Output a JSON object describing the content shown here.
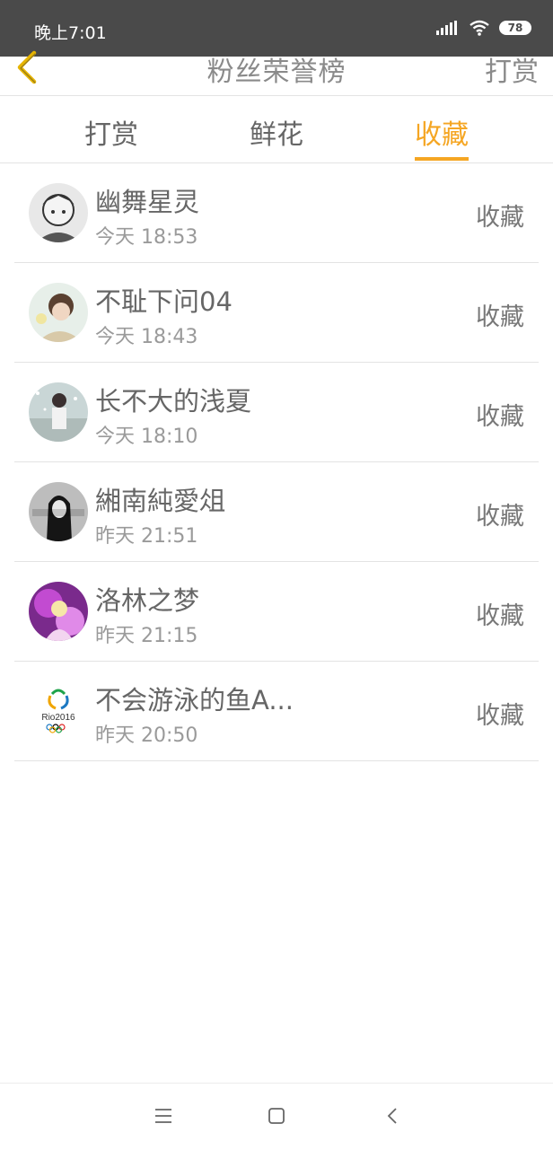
{
  "status": {
    "time": "晚上7:01",
    "battery": "78"
  },
  "header": {
    "title": "粉丝荣誉榜",
    "right_action": "打赏"
  },
  "tabs": [
    {
      "label": "打赏"
    },
    {
      "label": "鲜花"
    },
    {
      "label": "收藏"
    }
  ],
  "active_tab": "收藏",
  "fans": [
    {
      "name": "幽舞星灵",
      "time": "今天 18:53",
      "tag": "收藏"
    },
    {
      "name": "不耻下问04",
      "time": "今天 18:43",
      "tag": "收藏"
    },
    {
      "name": "长不大的浅夏",
      "time": "今天 18:10",
      "tag": "收藏"
    },
    {
      "name": "緗南純愛俎",
      "time": "昨天 21:51",
      "tag": "收藏"
    },
    {
      "name": "洛林之梦",
      "time": "昨天 21:15",
      "tag": "收藏"
    },
    {
      "name": "不会游泳的鱼A...",
      "time": "昨天 20:50",
      "tag": "收藏"
    }
  ],
  "avatar_texts": {
    "rio": "Rio2016"
  },
  "colors": {
    "accent": "#f5a623",
    "statusbar": "#4a4a4a",
    "divider": "#e3e3e3"
  }
}
